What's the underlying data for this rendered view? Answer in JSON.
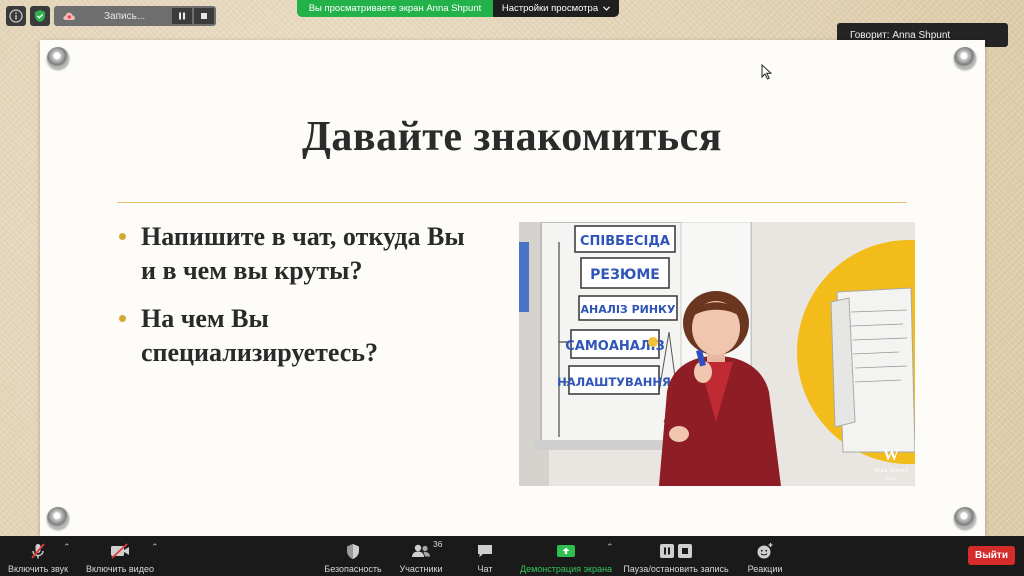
{
  "top": {
    "recording_label": "Запись...",
    "share_banner": "Вы просматриваете экран Anna Shpunt",
    "view_options": "Настройки просмотра",
    "speaker": "Говорит: Anna Shpunt"
  },
  "slide": {
    "title": "Давайте знакомиться",
    "bullets": [
      "Напишите в чат, откуда Вы и в чем вы круты?",
      "На чем Вы специализируетесь?"
    ],
    "photo": {
      "board_words": [
        "СПІВБЕСІДА",
        "РЕЗЮМЕ",
        "АНАЛІЗ РИНКУ",
        "САМОАНАЛІЗ",
        "НАЛАШТУВАННЯ"
      ],
      "logo_letter": "W",
      "logo_line1": "Work Service",
      "logo_line2": "Lviv"
    }
  },
  "toolbar": {
    "mute": "Включить звук",
    "video": "Включить видео",
    "security": "Безопасность",
    "participants": "Участники",
    "participants_count": "36",
    "chat": "Чат",
    "share": "Демонстрация экрана",
    "pause_record": "Пауза/остановить запись",
    "reactions": "Реакции",
    "leave": "Выйти"
  },
  "colors": {
    "share_green": "#23b24a",
    "leave_red": "#d42b2b",
    "bullet_gold": "#d5a836"
  }
}
